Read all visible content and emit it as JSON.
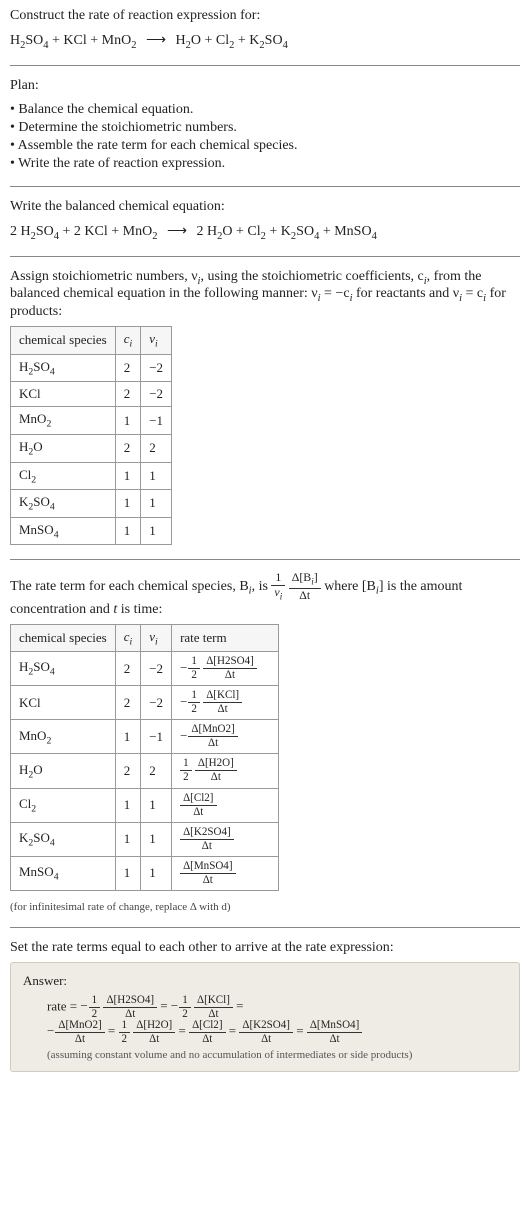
{
  "intro": {
    "heading": "Construct the rate of reaction expression for:",
    "equation_left": [
      "H",
      "2",
      "SO",
      "4",
      " + KCl + MnO",
      "2"
    ],
    "equation_right": [
      "H",
      "2",
      "O + Cl",
      "2",
      " + K",
      "2",
      "SO",
      "4",
      " + MnSO",
      "4"
    ],
    "arrow": "⟶"
  },
  "plan": {
    "heading": "Plan:",
    "bullets": [
      "• Balance the chemical equation.",
      "• Determine the stoichiometric numbers.",
      "• Assemble the rate term for each chemical species.",
      "• Write the rate of reaction expression."
    ]
  },
  "balanced": {
    "heading": "Write the balanced chemical equation:",
    "lhs_c1": "2 ",
    "lhs_sp1_a": "H",
    "lhs_sp1_b": "2",
    "lhs_sp1_c": "SO",
    "lhs_sp1_d": "4",
    "plus1": " + 2 KCl + MnO",
    "lhs_sp3_b": "2",
    "arrow": "⟶",
    "rhs_c1": " 2 H",
    "rhs_sp1_b": "2",
    "rhs_sp1_c": "O + Cl",
    "rhs_sp2_b": "2",
    "rhs_mid": " + K",
    "rhs_sp3_b": "2",
    "rhs_sp3_c": "SO",
    "rhs_sp3_d": "4",
    "rhs_tail": " + MnSO",
    "rhs_sp4_b": "4"
  },
  "assign": {
    "text_a": "Assign stoichiometric numbers, ν",
    "sub_i1": "i",
    "text_b": ", using the stoichiometric coefficients, c",
    "sub_i2": "i",
    "text_c": ", from the balanced chemical equation in the following manner: ν",
    "sub_i3": "i",
    "text_d": " = −c",
    "sub_i4": "i",
    "text_e": " for reactants and ν",
    "sub_i5": "i",
    "text_f": " = c",
    "sub_i6": "i",
    "text_g": " for products:"
  },
  "table1": {
    "headers": [
      "chemical species",
      "cᵢ",
      "νᵢ"
    ],
    "rows": [
      {
        "sp_a": "H",
        "sp_b": "2",
        "sp_c": "SO",
        "sp_d": "4",
        "c": "2",
        "v": "−2"
      },
      {
        "sp_a": "KCl",
        "sp_b": "",
        "sp_c": "",
        "sp_d": "",
        "c": "2",
        "v": "−2"
      },
      {
        "sp_a": "MnO",
        "sp_b": "2",
        "sp_c": "",
        "sp_d": "",
        "c": "1",
        "v": "−1"
      },
      {
        "sp_a": "H",
        "sp_b": "2",
        "sp_c": "O",
        "sp_d": "",
        "c": "2",
        "v": "2"
      },
      {
        "sp_a": "Cl",
        "sp_b": "2",
        "sp_c": "",
        "sp_d": "",
        "c": "1",
        "v": "1"
      },
      {
        "sp_a": "K",
        "sp_b": "2",
        "sp_c": "SO",
        "sp_d": "4",
        "c": "1",
        "v": "1"
      },
      {
        "sp_a": "MnSO",
        "sp_b": "4",
        "sp_c": "",
        "sp_d": "",
        "c": "1",
        "v": "1"
      }
    ]
  },
  "rateterm_intro": {
    "a": "The rate term for each chemical species, B",
    "sub_i": "i",
    "b": ", is ",
    "frac1_num": "1",
    "frac1_den_a": "ν",
    "frac1_den_b": "i",
    "frac2_num_a": "Δ[B",
    "frac2_num_b": "i",
    "frac2_num_c": "]",
    "frac2_den": "Δt",
    "c": " where [B",
    "sub_i2": "i",
    "d": "] is the amount concentration and ",
    "t": "t",
    "e": " is time:"
  },
  "table2": {
    "headers": [
      "chemical species",
      "cᵢ",
      "νᵢ",
      "rate term"
    ],
    "rows": [
      {
        "sp_a": "H",
        "sp_b": "2",
        "sp_c": "SO",
        "sp_d": "4",
        "c": "2",
        "v": "−2",
        "neg": "−",
        "num1": "1",
        "den1": "2",
        "num2": "Δ[H2SO4]",
        "den2": "Δt"
      },
      {
        "sp_a": "KCl",
        "sp_b": "",
        "sp_c": "",
        "sp_d": "",
        "c": "2",
        "v": "−2",
        "neg": "−",
        "num1": "1",
        "den1": "2",
        "num2": "Δ[KCl]",
        "den2": "Δt"
      },
      {
        "sp_a": "MnO",
        "sp_b": "2",
        "sp_c": "",
        "sp_d": "",
        "c": "1",
        "v": "−1",
        "neg": "−",
        "num1": "",
        "den1": "",
        "num2": "Δ[MnO2]",
        "den2": "Δt"
      },
      {
        "sp_a": "H",
        "sp_b": "2",
        "sp_c": "O",
        "sp_d": "",
        "c": "2",
        "v": "2",
        "neg": "",
        "num1": "1",
        "den1": "2",
        "num2": "Δ[H2O]",
        "den2": "Δt"
      },
      {
        "sp_a": "Cl",
        "sp_b": "2",
        "sp_c": "",
        "sp_d": "",
        "c": "1",
        "v": "1",
        "neg": "",
        "num1": "",
        "den1": "",
        "num2": "Δ[Cl2]",
        "den2": "Δt"
      },
      {
        "sp_a": "K",
        "sp_b": "2",
        "sp_c": "SO",
        "sp_d": "4",
        "c": "1",
        "v": "1",
        "neg": "",
        "num1": "",
        "den1": "",
        "num2": "Δ[K2SO4]",
        "den2": "Δt"
      },
      {
        "sp_a": "MnSO",
        "sp_b": "4",
        "sp_c": "",
        "sp_d": "",
        "c": "1",
        "v": "1",
        "neg": "",
        "num1": "",
        "den1": "",
        "num2": "Δ[MnSO4]",
        "den2": "Δt"
      }
    ]
  },
  "note_inf": "(for infinitesimal rate of change, replace Δ with d)",
  "set_equal": "Set the rate terms equal to each other to arrive at the rate expression:",
  "answer": {
    "label": "Answer:",
    "rate_prefix": "rate = ",
    "terms": [
      {
        "neg": "−",
        "num1": "1",
        "den1": "2",
        "num2": "Δ[H2SO4]",
        "den2": "Δt",
        "eq": " = "
      },
      {
        "neg": "−",
        "num1": "1",
        "den1": "2",
        "num2": "Δ[KCl]",
        "den2": "Δt",
        "eq": " ="
      },
      {
        "break": "1"
      },
      {
        "neg": "−",
        "num1": "",
        "den1": "",
        "num2": "Δ[MnO2]",
        "den2": "Δt",
        "eq": " = "
      },
      {
        "neg": "",
        "num1": "1",
        "den1": "2",
        "num2": "Δ[H2O]",
        "den2": "Δt",
        "eq": " = "
      },
      {
        "neg": "",
        "num1": "",
        "den1": "",
        "num2": "Δ[Cl2]",
        "den2": "Δt",
        "eq": " = "
      },
      {
        "neg": "",
        "num1": "",
        "den1": "",
        "num2": "Δ[K2SO4]",
        "den2": "Δt",
        "eq": " = "
      },
      {
        "neg": "",
        "num1": "",
        "den1": "",
        "num2": "Δ[MnSO4]",
        "den2": "Δt",
        "eq": ""
      }
    ],
    "note": "(assuming constant volume and no accumulation of intermediates or side products)"
  }
}
